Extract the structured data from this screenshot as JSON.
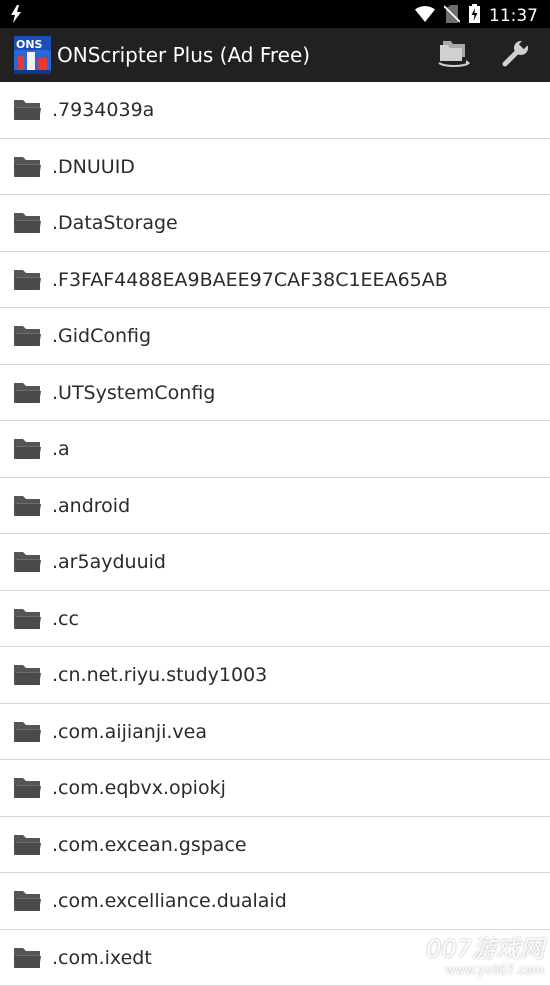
{
  "status_bar": {
    "time": "11:37",
    "icons": [
      "flash-icon",
      "wifi-icon",
      "no-sim-icon",
      "battery-charging-icon"
    ]
  },
  "app_bar": {
    "logo_text": "ONS",
    "title": "ONScripter Plus (Ad Free)",
    "actions": [
      "folders-icon",
      "wrench-icon"
    ]
  },
  "list": {
    "items": [
      ".7934039a",
      ".DNUUID",
      ".DataStorage",
      ".F3FAF4488EA9BAEE97CAF38C1EEA65AB",
      ".GidConfig",
      ".UTSystemConfig",
      ".a",
      ".android",
      ".ar5ayduuid",
      ".cc",
      ".cn.net.riyu.study1003",
      ".com.aijianji.vea",
      ".com.eqbvx.opiokj",
      ".com.excean.gspace",
      ".com.excelliance.dualaid",
      ".com.ixedt"
    ]
  },
  "watermark": {
    "line1": "007游戏网",
    "line2": "www.yx007.com"
  }
}
